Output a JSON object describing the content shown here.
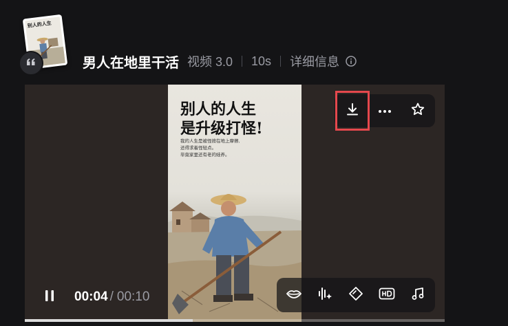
{
  "header": {
    "thumbnail_caption": "别人的人生",
    "title": "男人在地里干活",
    "model": "视频 3.0",
    "duration": "10s",
    "details_label": "详细信息"
  },
  "poster": {
    "headline_line1": "别人的人生",
    "headline_line2": "是升级打怪!",
    "body_line1": "我的人生是被怪按在地上摩擦,",
    "body_line2": "还得求着怪轻点。",
    "body_line3": "毕竟家里还有老的娃养。"
  },
  "player": {
    "current_time": "00:04",
    "time_separator": "/",
    "total_time": "00:10",
    "progress_fraction": 0.4
  },
  "icons": {
    "quote": "quote-icon",
    "info": "info-icon",
    "download": "download-icon",
    "more": "more-icon",
    "favorite": "star-icon",
    "pause": "pause-icon",
    "lip_sync": "lips-icon",
    "audio": "audio-wave-icon",
    "keyframe": "diamond-icon",
    "hd": "hd-icon",
    "music": "music-note-icon"
  },
  "colors": {
    "background": "#141416",
    "highlight": "#e5484d",
    "muted_text": "#9a9ba3"
  }
}
